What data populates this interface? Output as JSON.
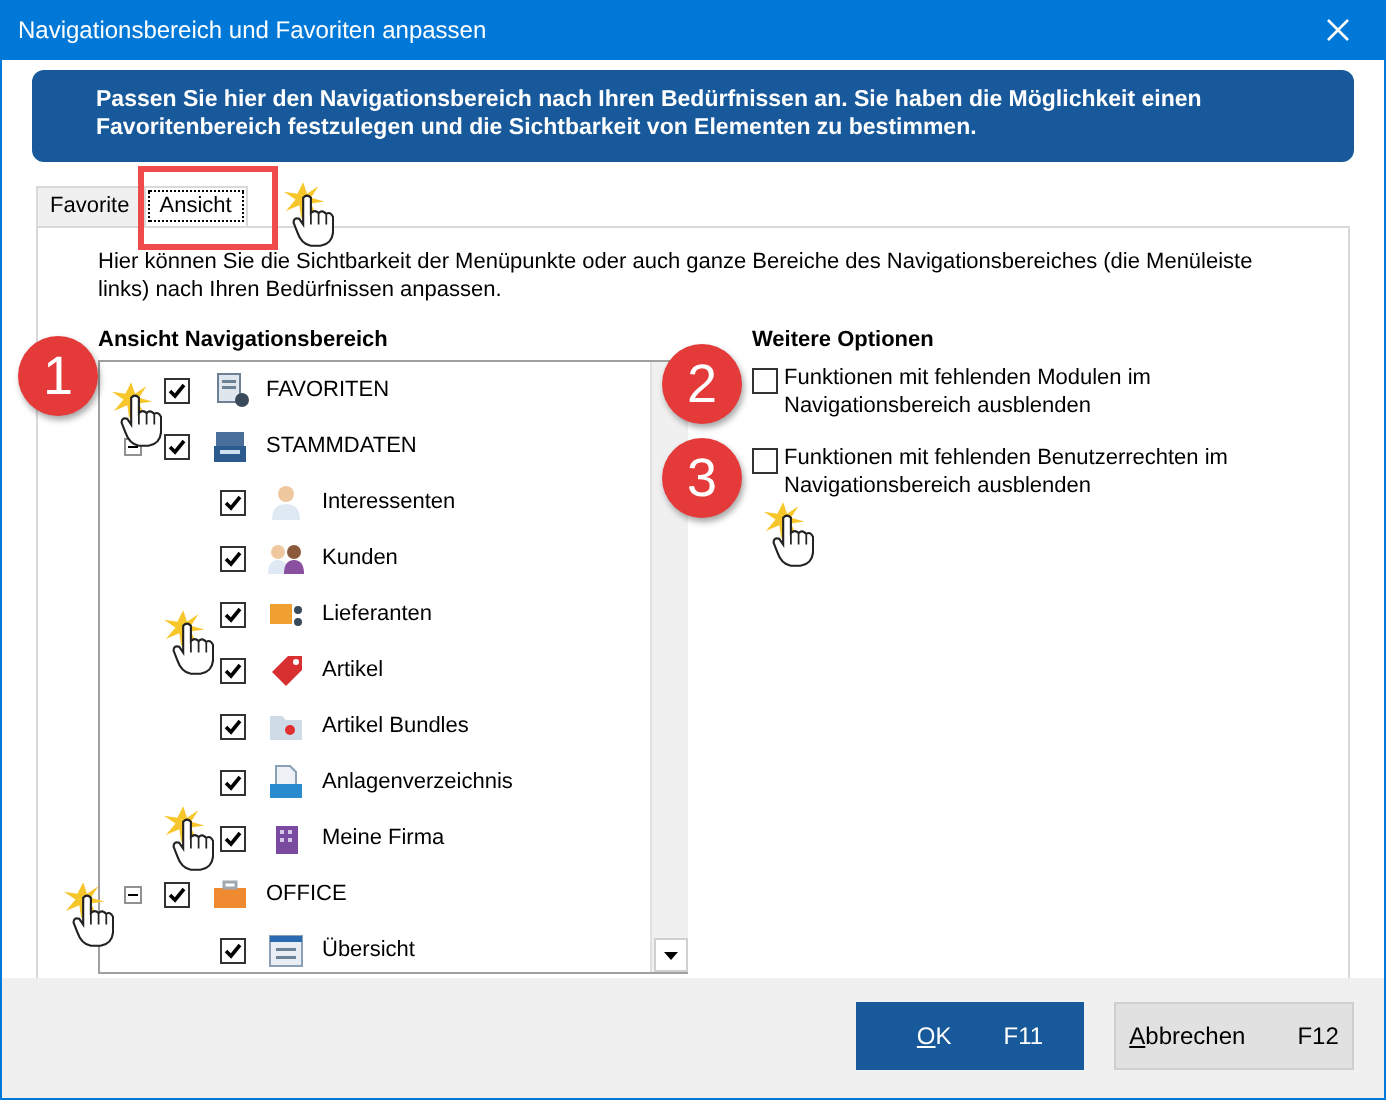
{
  "window": {
    "title": "Navigationsbereich und Favoriten anpassen"
  },
  "banner": "Passen Sie hier den Navigationsbereich nach Ihren Bedürfnissen an. Sie haben die Möglichkeit einen Favoritenbereich festzulegen und die Sichtbarkeit von Elementen zu bestimmen.",
  "tabs": [
    {
      "label": "Favorite",
      "selected": false
    },
    {
      "label": "Ansicht",
      "selected": true
    }
  ],
  "intro": "Hier können Sie die Sichtbarkeit der Menüpunkte oder auch ganze Bereiche des Navigationsbereiches (die Menüleiste links) nach Ihren Bedürfnissen anpassen.",
  "tree": {
    "heading": "Ansicht Navigationsbereich",
    "items": [
      {
        "label": "FAVORITEN",
        "checked": true
      },
      {
        "label": "STAMMDATEN",
        "checked": true,
        "expanded": true,
        "children": [
          {
            "label": "Interessenten",
            "checked": true
          },
          {
            "label": "Kunden",
            "checked": true
          },
          {
            "label": "Lieferanten",
            "checked": true
          },
          {
            "label": "Artikel",
            "checked": true
          },
          {
            "label": "Artikel Bundles",
            "checked": true
          },
          {
            "label": "Anlagenverzeichnis",
            "checked": true
          },
          {
            "label": "Meine Firma",
            "checked": true
          }
        ]
      },
      {
        "label": "OFFICE",
        "checked": true,
        "expanded": true,
        "children": [
          {
            "label": "Übersicht",
            "checked": true
          }
        ]
      }
    ]
  },
  "options": {
    "heading": "Weitere Optionen",
    "items": [
      {
        "label": "Funktionen mit fehlenden Modulen im Navigationsbereich ausblenden",
        "checked": false
      },
      {
        "label": "Funktionen mit fehlenden Benutzerrechten im Navigationsbereich ausblenden",
        "checked": false
      }
    ]
  },
  "callouts": [
    {
      "number": "1"
    },
    {
      "number": "2"
    },
    {
      "number": "3"
    }
  ],
  "buttons": [
    {
      "label": "OK",
      "shortcut": "F11",
      "kind": "primary"
    },
    {
      "label": "Abbrechen",
      "shortcut": "F12",
      "kind": "secondary"
    }
  ]
}
